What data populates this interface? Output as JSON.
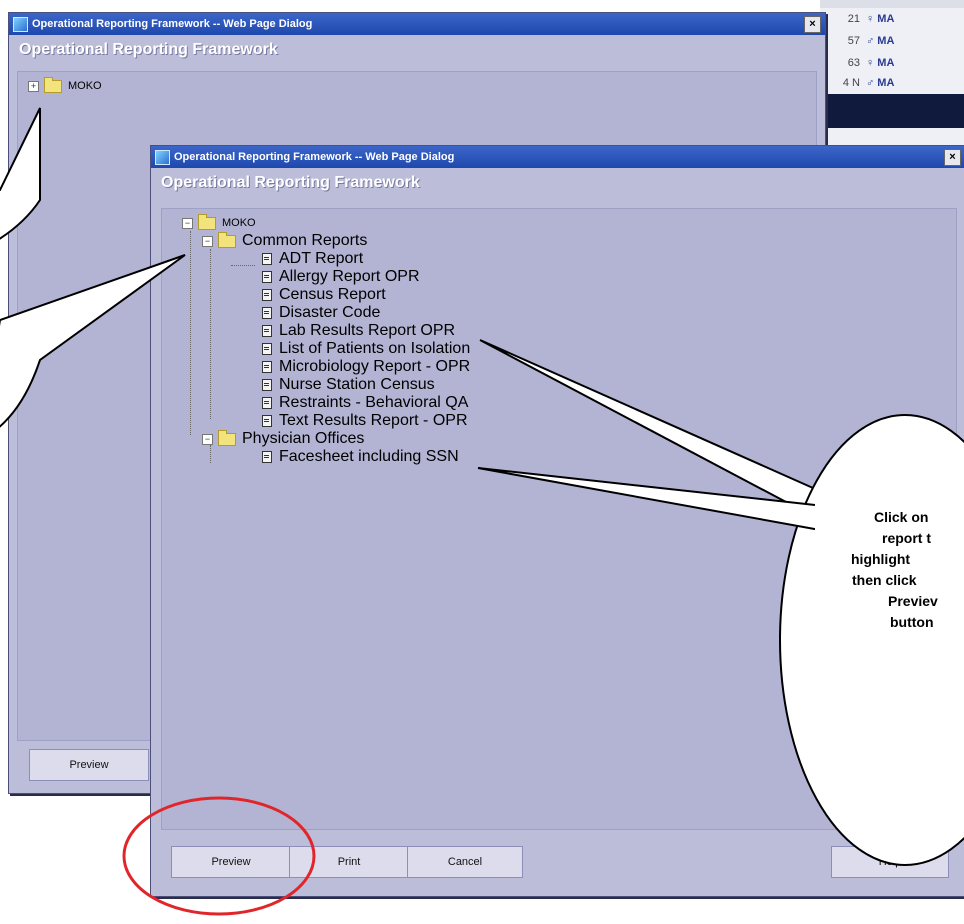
{
  "background_app": {
    "rows": [
      {
        "num": "21",
        "gender": "♀ MA"
      },
      {
        "num": "57",
        "gender": "♂ MA"
      },
      {
        "num": "63",
        "gender": "♀ MA"
      },
      {
        "num": "4 N",
        "gender": "♂ MA"
      }
    ]
  },
  "dialog_back": {
    "title": "Operational Reporting Framework -- Web Page Dialog",
    "close_label": "×",
    "heading": "Operational Reporting Framework",
    "tree_root": "MOKO",
    "preview_label": "Preview"
  },
  "dialog_front": {
    "title": "Operational Reporting Framework -- Web Page Dialog",
    "close_label": "×",
    "heading": "Operational Reporting Framework",
    "tree": {
      "root": "MOKO",
      "groups": [
        {
          "label": "Common Reports",
          "items": [
            "ADT Report",
            "Allergy Report OPR",
            "Census Report",
            "Disaster Code",
            "Lab Results Report OPR",
            "List of Patients on Isolation",
            "Microbiology Report - OPR",
            "Nurse Station Census",
            "Restraints - Behavioral QA",
            "Text Results Report - OPR"
          ]
        },
        {
          "label": "Physician Offices",
          "items": [
            "Facesheet including SSN"
          ]
        }
      ]
    },
    "buttons": {
      "preview": "Preview",
      "print": "Print",
      "cancel": "Cancel",
      "help": "Help"
    }
  },
  "callout": {
    "lines": [
      "Click on",
      "report t",
      "highlight",
      "then click",
      "Previev",
      "button"
    ]
  },
  "colors": {
    "dialog_bg": "#bcbdd9",
    "titlebar": "#1e48ad",
    "highlight_circle": "#e0262a"
  }
}
